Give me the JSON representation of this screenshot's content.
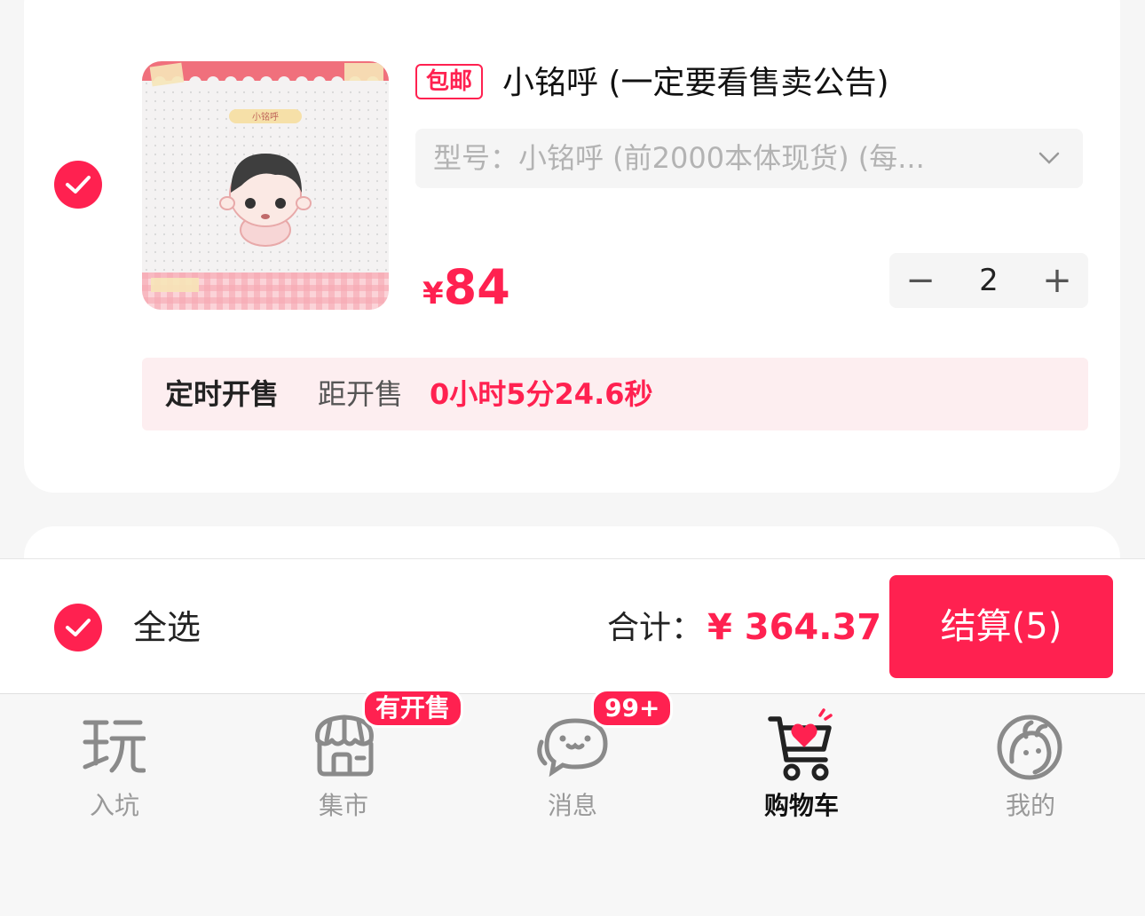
{
  "item": {
    "badge": "包邮",
    "title": "小铭呼 (一定要看售卖公告)",
    "variant": "型号：小铭呼 (前2000本体现货) (每...",
    "price_symbol": "¥",
    "price": "84",
    "quantity": "2",
    "minus": "−",
    "plus": "+",
    "timer_label": "定时开售",
    "timer_prefix": "距开售",
    "timer_value": "0小时5分24.6秒",
    "thumb_caption": "小铭呼"
  },
  "footer": {
    "select_all": "全选",
    "total_label": "合计：",
    "total_value": "¥ 364.37",
    "checkout": "结算(5)"
  },
  "tabs": [
    {
      "label": "入坑",
      "icon": "play-icon"
    },
    {
      "label": "集市",
      "icon": "market-icon",
      "badge": "有开售"
    },
    {
      "label": "消息",
      "icon": "message-icon",
      "badge": "99+"
    },
    {
      "label": "购物车",
      "icon": "cart-icon",
      "active": true
    },
    {
      "label": "我的",
      "icon": "profile-icon"
    }
  ],
  "colors": {
    "accent": "#ff2150"
  }
}
